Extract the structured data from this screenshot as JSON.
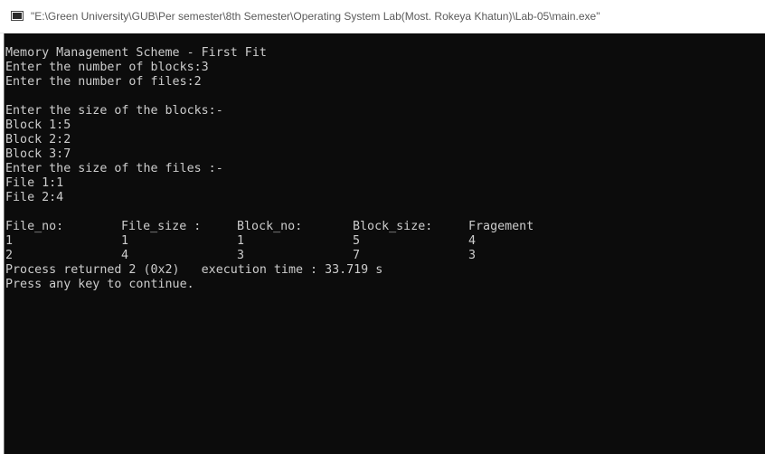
{
  "window": {
    "title": "\"E:\\Green University\\GUB\\Per semester\\8th Semester\\Operating System Lab(Most. Rokeya Khatun)\\Lab-05\\main.exe\""
  },
  "console": {
    "header": "Memory Management Scheme - First Fit",
    "blocks_prompt": "Enter the number of blocks:3",
    "files_prompt": "Enter the number of files:2",
    "blank": "",
    "block_size_prompt": "Enter the size of the blocks:-",
    "block_lines": [
      "Block 1:5",
      "Block 2:2",
      "Block 3:7"
    ],
    "file_size_prompt": "Enter the size of the files :-",
    "file_lines": [
      "File 1:1",
      "File 2:4"
    ],
    "table_headers": [
      "File_no:",
      "File_size :",
      "Block_no:",
      "Block_size:",
      "Fragement"
    ],
    "table_rows": [
      [
        "1",
        "1",
        "1",
        "5",
        "4"
      ],
      [
        "2",
        "4",
        "3",
        "7",
        "3"
      ]
    ],
    "process_returned": "Process returned 2 (0x2)   execution time : 33.719 s",
    "press_key": "Press any key to continue."
  },
  "colors": {
    "console_bg": "#0c0c0c",
    "console_text": "#cccccc",
    "title_text": "#5a5a5a"
  }
}
